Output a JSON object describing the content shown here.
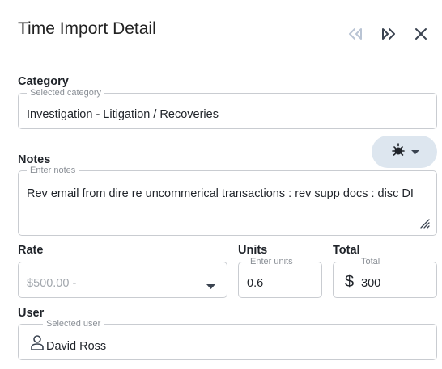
{
  "header": {
    "title": "Time Import Detail",
    "icons": {
      "prev": "rewind-icon",
      "next": "fast-forward-icon",
      "close": "close-icon"
    }
  },
  "category": {
    "label": "Category",
    "legend": "Selected category",
    "value": "Investigation - Litigation / Recoveries"
  },
  "notes": {
    "label": "Notes",
    "legend": "Enter notes",
    "value": "Rev email from dire re uncommerical transactions : rev supp docs : disc DI",
    "idea_icon": "lightbulb-icon"
  },
  "rate": {
    "label": "Rate",
    "placeholder": "$500.00 -"
  },
  "units": {
    "label": "Units",
    "legend": "Enter units",
    "value": "0.6"
  },
  "total": {
    "label": "Total",
    "legend": "Total",
    "currency": "$",
    "value": "300"
  },
  "user": {
    "label": "User",
    "legend": "Selected user",
    "value": "David Ross",
    "icon": "person-icon"
  },
  "colors": {
    "idea_button_bg": "#dde6ef",
    "border": "#c9ccd1",
    "muted_text": "#a3a8ae",
    "disabled_icon": "#b9c4d4"
  }
}
